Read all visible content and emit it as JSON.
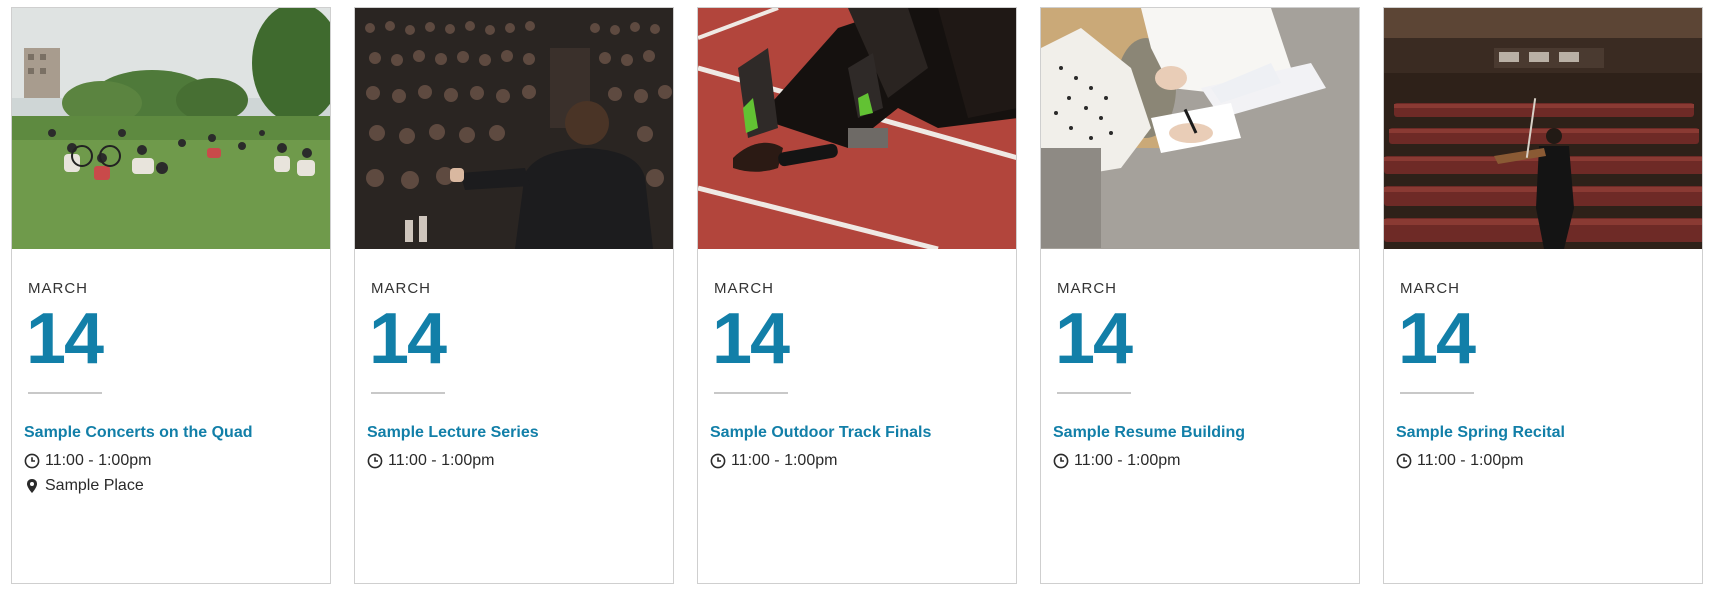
{
  "events": [
    {
      "image": "picnic-on-lawn-photo",
      "month": "MARCH",
      "day": "14",
      "title": "Sample Concerts on the Quad",
      "time": "11:00 - 1:00pm",
      "location": "Sample Place"
    },
    {
      "image": "lecture-hall-photo",
      "month": "MARCH",
      "day": "14",
      "title": "Sample Lecture Series",
      "time": "11:00 - 1:00pm"
    },
    {
      "image": "track-starting-blocks-photo",
      "month": "MARCH",
      "day": "14",
      "title": "Sample Outdoor Track Finals",
      "time": "11:00 - 1:00pm"
    },
    {
      "image": "resume-paperwork-photo",
      "month": "MARCH",
      "day": "14",
      "title": "Sample Resume Building",
      "time": "11:00 - 1:00pm"
    },
    {
      "image": "violinist-on-stage-photo",
      "month": "MARCH",
      "day": "14",
      "title": "Sample Spring Recital",
      "time": "11:00 - 1:00pm"
    }
  ],
  "colors": {
    "accent": "#127fa8",
    "text": "#2a2a2a",
    "border": "#cfcfcf",
    "divider": "#c8c8c8"
  },
  "icons": {
    "time": "clock-icon",
    "location": "map-pin-icon"
  }
}
